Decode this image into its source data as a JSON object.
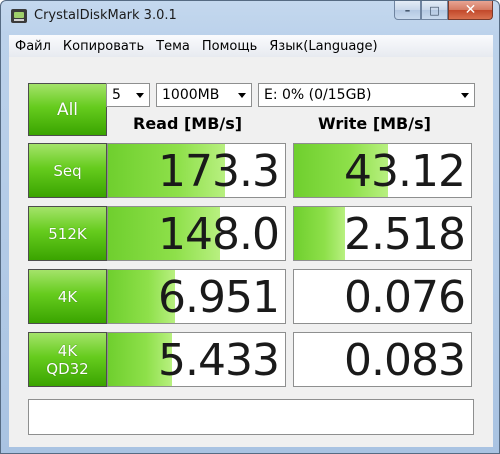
{
  "window": {
    "title": "CrystalDiskMark 3.0.1",
    "caption": {
      "minimize": "–",
      "maximize": "□",
      "close": "✕"
    }
  },
  "menu": [
    "Файл",
    "Копировать",
    "Тема",
    "Помощь",
    "Язык(Language)"
  ],
  "controls": {
    "all_label": "All",
    "runs": "5",
    "size": "1000MB",
    "drive": "E: 0% (0/15GB)"
  },
  "headers": {
    "read": "Read [MB/s]",
    "write": "Write [MB/s]"
  },
  "rows": [
    {
      "label1": "Seq",
      "label2": "",
      "read": "173.3",
      "write": "43.12",
      "read_fill": 0.66,
      "write_fill": 0.53
    },
    {
      "label1": "512K",
      "label2": "",
      "read": "148.0",
      "write": "2.518",
      "read_fill": 0.63,
      "write_fill": 0.29
    },
    {
      "label1": "4K",
      "label2": "",
      "read": "6.951",
      "write": "0.076",
      "read_fill": 0.38,
      "write_fill": 0.0
    },
    {
      "label1": "4K",
      "label2": "QD32",
      "read": "5.433",
      "write": "0.083",
      "read_fill": 0.36,
      "write_fill": 0.0
    }
  ],
  "status_text": "",
  "colors": {
    "accent_green": "#66cc1e",
    "bar_green": "#8ee04a"
  }
}
